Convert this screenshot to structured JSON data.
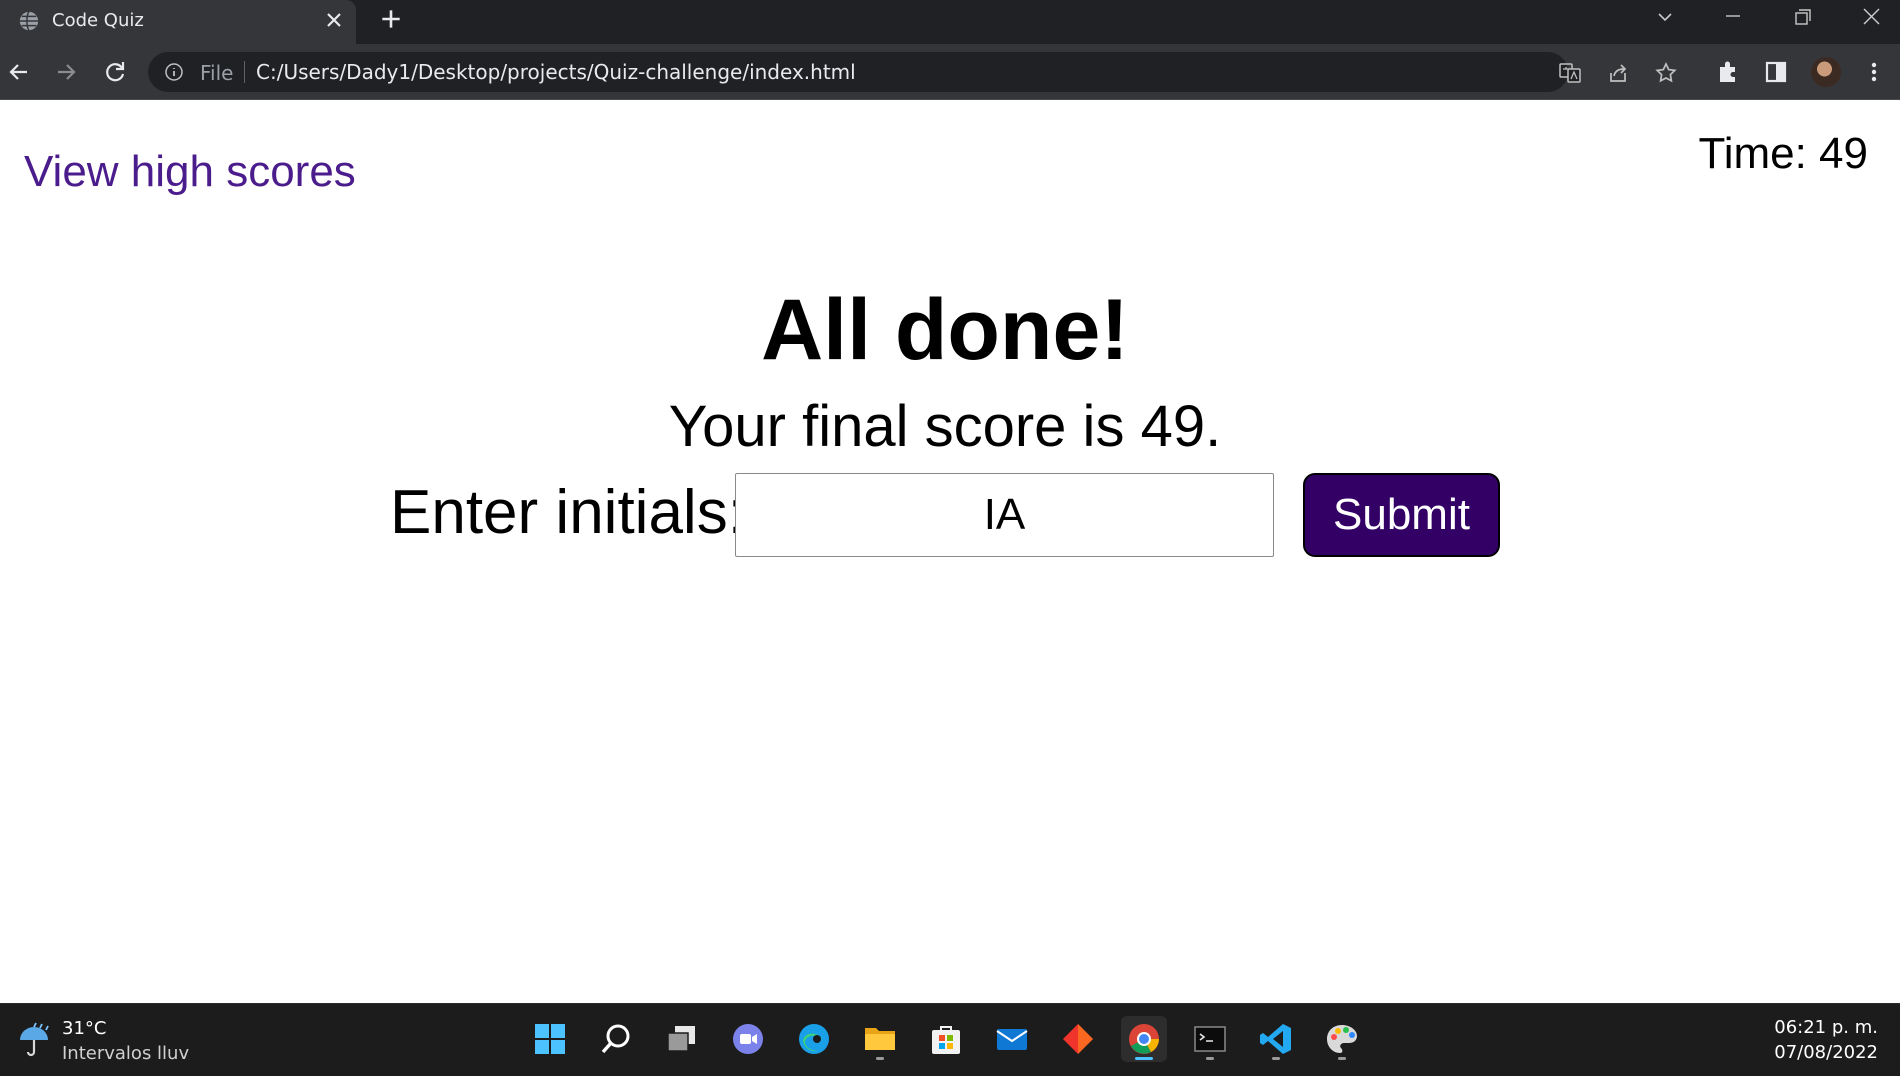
{
  "browser": {
    "tab_title": "Code Quiz",
    "address_prefix": "File",
    "url": "C:/Users/Dady1/Desktop/projects/Quiz-challenge/index.html",
    "icons": {
      "favicon": "globe-icon",
      "tab_close": "close-icon",
      "new_tab": "plus-icon",
      "back": "back-arrow-icon",
      "forward": "forward-arrow-icon",
      "reload": "reload-icon",
      "site_info": "info-icon",
      "translate": "translate-icon",
      "share": "share-icon",
      "bookmark": "star-icon",
      "extensions": "puzzle-icon",
      "side_panel": "side-panel-icon",
      "profile": "avatar",
      "menu": "kebab-menu-icon",
      "tab_search": "chevron-down-icon",
      "minimize": "minimize-icon",
      "restore": "restore-icon",
      "close_window": "close-window-icon"
    }
  },
  "page": {
    "high_scores_link": "View high scores",
    "timer_label": "Time: ",
    "timer_value": "49",
    "heading": "All done!",
    "final_score_text": "Your final score is ",
    "final_score_value": "49",
    "final_score_suffix": ".",
    "initials_label": "Enter initials:",
    "initials_value": "IA",
    "submit_label": "Submit",
    "colors": {
      "link": "#4b1c8c",
      "submit_bg": "#330066",
      "submit_text": "#ffffff"
    }
  },
  "taskbar": {
    "weather": {
      "temp": "31°C",
      "desc": "Intervalos lluv",
      "icon": "rain-umbrella-icon"
    },
    "apps": [
      {
        "name": "windows-start-icon",
        "active": false,
        "running": false
      },
      {
        "name": "search-icon",
        "active": false,
        "running": false
      },
      {
        "name": "task-view-icon",
        "active": false,
        "running": false
      },
      {
        "name": "teams-chat-icon",
        "active": false,
        "running": false
      },
      {
        "name": "edge-icon",
        "active": false,
        "running": false
      },
      {
        "name": "file-explorer-icon",
        "active": false,
        "running": true
      },
      {
        "name": "microsoft-store-icon",
        "active": false,
        "running": false
      },
      {
        "name": "mail-icon",
        "active": false,
        "running": false
      },
      {
        "name": "git-app-icon",
        "active": false,
        "running": false
      },
      {
        "name": "chrome-icon",
        "active": true,
        "running": true
      },
      {
        "name": "terminal-icon",
        "active": false,
        "running": true
      },
      {
        "name": "vscode-icon",
        "active": false,
        "running": true
      },
      {
        "name": "paint-icon",
        "active": false,
        "running": true
      }
    ],
    "clock_time": "06:21 p. m.",
    "clock_date": "07/08/2022"
  }
}
